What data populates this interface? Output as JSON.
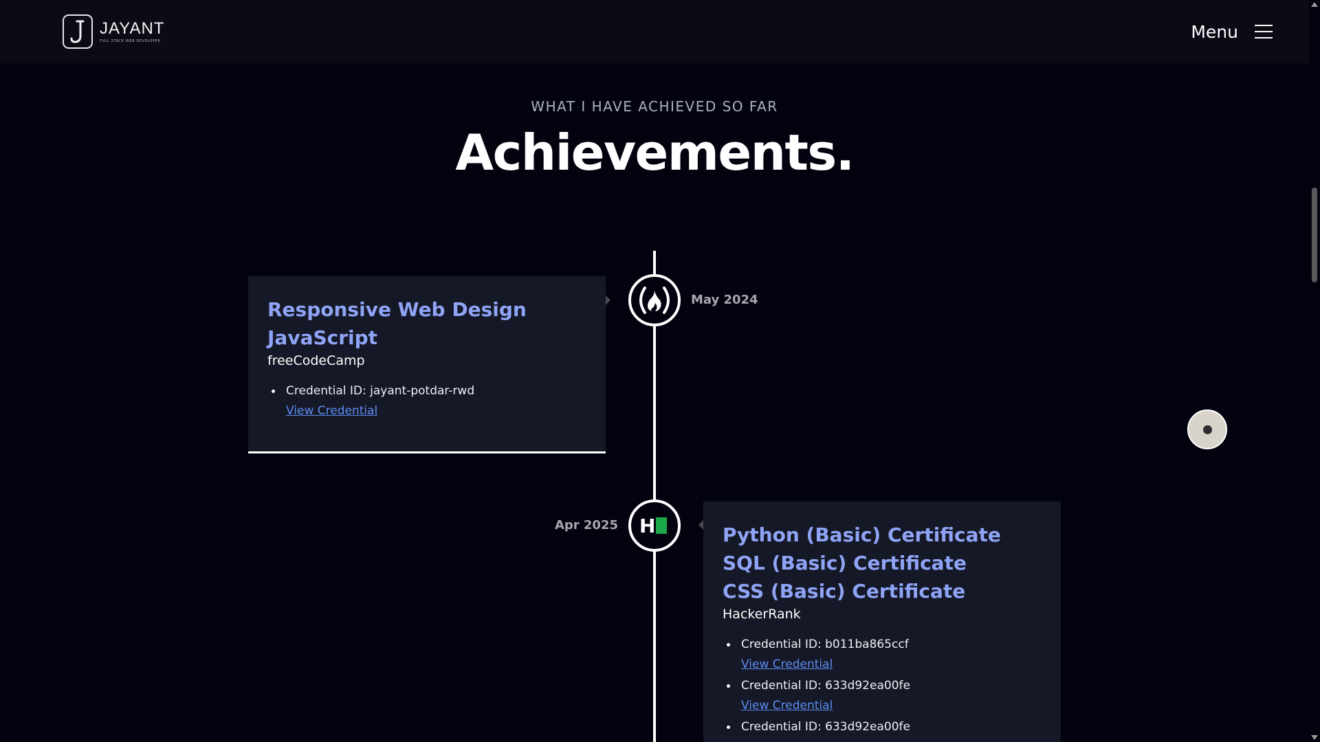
{
  "header": {
    "logo_letter": "J",
    "logo_name": "JAYANT",
    "logo_tagline": "FULL STACK WEB DEVELOPER",
    "menu_label": "Menu"
  },
  "section": {
    "subtitle": "WHAT I HAVE ACHIEVED SO FAR",
    "title": "Achievements."
  },
  "achievements": [
    {
      "date": "May 2024",
      "icon": "freecodecamp-icon",
      "titles": [
        "Responsive Web Design",
        "JavaScript"
      ],
      "issuer": "freeCodeCamp",
      "credentials": [
        {
          "id_text": "Credential ID: jayant-potdar-rwd",
          "link_label": "View Credential"
        }
      ]
    },
    {
      "date": "Apr 2025",
      "icon": "hackerrank-icon",
      "icon_text": "H",
      "titles": [
        "Python (Basic) Certificate",
        "SQL (Basic) Certificate",
        "CSS (Basic) Certificate"
      ],
      "issuer": "HackerRank",
      "credentials": [
        {
          "id_text": "Credential ID: b011ba865ccf",
          "link_label": "View Credential"
        },
        {
          "id_text": "Credential ID: 633d92ea00fe",
          "link_label": "View Credential"
        },
        {
          "id_text": "Credential ID: 633d92ea00fe",
          "link_label": ""
        }
      ]
    }
  ],
  "colors": {
    "background": "#03020f",
    "card": "#151826",
    "card_title": "#8fa4f6",
    "link": "#5c8df4",
    "hackerrank_green": "#1ba94c"
  }
}
